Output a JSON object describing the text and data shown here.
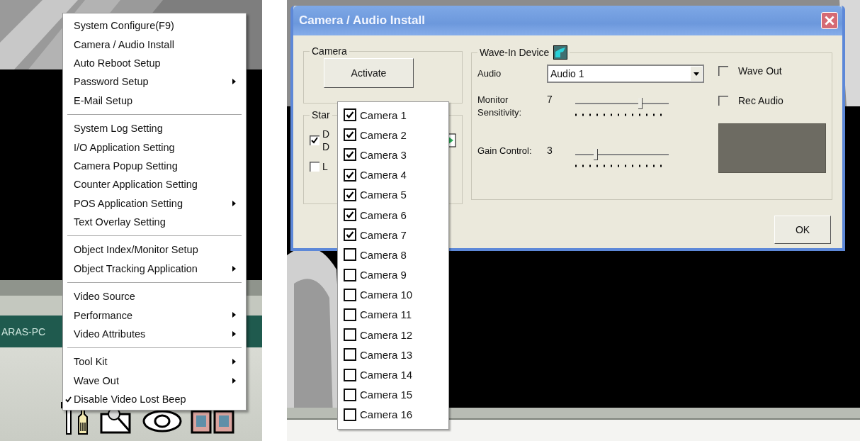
{
  "left_screen": {
    "host_label": "ARAS-PC"
  },
  "context_menu": {
    "groups": [
      {
        "items": [
          {
            "label": "System Configure(F9)",
            "submenu": false,
            "checked": false
          },
          {
            "label": "Camera / Audio Install",
            "submenu": false,
            "checked": false
          },
          {
            "label": "Auto Reboot Setup",
            "submenu": false,
            "checked": false
          },
          {
            "label": "Password Setup",
            "submenu": true,
            "checked": false
          },
          {
            "label": "E-Mail Setup",
            "submenu": false,
            "checked": false
          }
        ]
      },
      {
        "items": [
          {
            "label": "System Log Setting",
            "submenu": false,
            "checked": false
          },
          {
            "label": "I/O Application Setting",
            "submenu": false,
            "checked": false
          },
          {
            "label": "Camera Popup Setting",
            "submenu": false,
            "checked": false
          },
          {
            "label": "Counter Application Setting",
            "submenu": false,
            "checked": false
          },
          {
            "label": "POS Application Setting",
            "submenu": true,
            "checked": false
          },
          {
            "label": "Text Overlay Setting",
            "submenu": false,
            "checked": false
          }
        ]
      },
      {
        "items": [
          {
            "label": "Object Index/Monitor Setup",
            "submenu": false,
            "checked": false
          },
          {
            "label": "Object Tracking Application",
            "submenu": true,
            "checked": false
          }
        ]
      },
      {
        "items": [
          {
            "label": "Video Source",
            "submenu": false,
            "checked": false
          },
          {
            "label": "Performance",
            "submenu": true,
            "checked": false
          },
          {
            "label": "Video Attributes",
            "submenu": true,
            "checked": false
          }
        ]
      },
      {
        "items": [
          {
            "label": "Tool Kit",
            "submenu": true,
            "checked": false
          },
          {
            "label": "Wave Out",
            "submenu": true,
            "checked": false
          },
          {
            "label": "Disable Video Lost Beep",
            "submenu": false,
            "checked": true
          }
        ]
      }
    ]
  },
  "dialog": {
    "title": "Camera / Audio Install",
    "camera_group": {
      "title": "Camera",
      "button": "Activate"
    },
    "startup_group": {
      "title": "Star",
      "options": [
        {
          "lines": [
            "D",
            "D"
          ],
          "checked": true
        },
        {
          "lines": [
            "L"
          ],
          "checked": false
        }
      ]
    },
    "wave_in_group": {
      "title": "Wave-In Device",
      "audio_label": "Audio",
      "audio_value": "Audio 1",
      "sliders": [
        {
          "label": "Monitor Sensitivity:",
          "reading": "7",
          "level": 0.7
        },
        {
          "label": "Gain Control:",
          "reading": "3",
          "level": 0.22
        }
      ],
      "options": [
        {
          "label": "Wave Out",
          "checked": false
        },
        {
          "label": "Rec Audio",
          "checked": false
        }
      ]
    },
    "ok_button": "OK"
  },
  "camera_list": [
    {
      "label": "Camera 1",
      "checked": true
    },
    {
      "label": "Camera 2",
      "checked": true
    },
    {
      "label": "Camera 3",
      "checked": true
    },
    {
      "label": "Camera 4",
      "checked": true
    },
    {
      "label": "Camera 5",
      "checked": true
    },
    {
      "label": "Camera 6",
      "checked": true
    },
    {
      "label": "Camera 7",
      "checked": true
    },
    {
      "label": "Camera 8",
      "checked": false
    },
    {
      "label": "Camera 9",
      "checked": false
    },
    {
      "label": "Camera 10",
      "checked": false
    },
    {
      "label": "Camera 11",
      "checked": false
    },
    {
      "label": "Camera 12",
      "checked": false
    },
    {
      "label": "Camera 13",
      "checked": false
    },
    {
      "label": "Camera 14",
      "checked": false
    },
    {
      "label": "Camera 15",
      "checked": false
    },
    {
      "label": "Camera 16",
      "checked": false
    }
  ]
}
